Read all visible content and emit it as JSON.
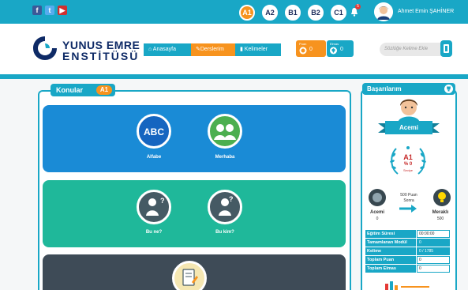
{
  "topbar": {
    "social": [
      {
        "name": "facebook",
        "glyph": "f",
        "color": "#3b5998"
      },
      {
        "name": "twitter",
        "glyph": "t",
        "color": "#55acee"
      },
      {
        "name": "youtube",
        "glyph": "▶",
        "color": "#d03030"
      }
    ],
    "levels": [
      "A1",
      "A2",
      "B1",
      "B2",
      "C1"
    ],
    "active_level": "A1",
    "notification_count": "5",
    "user_name": "Ahmet Emin ŞAHİNER"
  },
  "header": {
    "logo_line1": "YUNUS EMRE",
    "logo_line2": "ENSTİTÜSÜ",
    "nav": [
      {
        "label": "Anasayfa",
        "icon": "home-icon",
        "color": "#19a7c6"
      },
      {
        "label": "Derslerim",
        "icon": "pencil-icon",
        "color": "#f7931e"
      },
      {
        "label": "Kelimeler",
        "icon": "bookmark-icon",
        "color": "#19a7c6"
      }
    ],
    "points_label": "Puan",
    "points_value": "0",
    "diamond_label": "Elmas",
    "diamond_value": "0",
    "search_placeholder": "Sözlüğe Kelime Ekle"
  },
  "konular": {
    "title": "Konular",
    "level": "A1",
    "cards": [
      {
        "color": "#1a8bd6",
        "topics": [
          {
            "label": "Alfabe",
            "icon": "abc-icon"
          },
          {
            "label": "Merhaba",
            "icon": "people-icon"
          }
        ]
      },
      {
        "color": "#1fb89a",
        "topics": [
          {
            "label": "Bu ne?",
            "icon": "question-object-icon"
          },
          {
            "label": "Bu kim?",
            "icon": "question-person-icon"
          }
        ]
      },
      {
        "color": "#3e4b57",
        "topics": [
          {
            "label": "",
            "icon": "notebook-icon"
          }
        ]
      }
    ]
  },
  "basarilarim": {
    "title": "Başarılarım",
    "rank": "Acemi",
    "wreath_level": "A1",
    "wreath_percent": "% 0",
    "wreath_sub": "Seviye",
    "from_rank": "Acemi",
    "from_value": "0",
    "to_rank": "Meraklı",
    "to_value": "500",
    "next_text_1": "500 Puan",
    "next_text_2": "Sonra",
    "stats": [
      {
        "label": "Eğitim Süresi",
        "value": "00:00:00"
      },
      {
        "label": "Tamamlanan Modül",
        "value": "0"
      },
      {
        "label": "Kelime",
        "value": "0 / 1785"
      },
      {
        "label": "Toplam Puan",
        "value": "0"
      },
      {
        "label": "Toplam Elmas",
        "value": "0"
      }
    ]
  },
  "colors": {
    "primary": "#19a7c6",
    "accent": "#f7931e",
    "navy": "#0e2a66"
  }
}
